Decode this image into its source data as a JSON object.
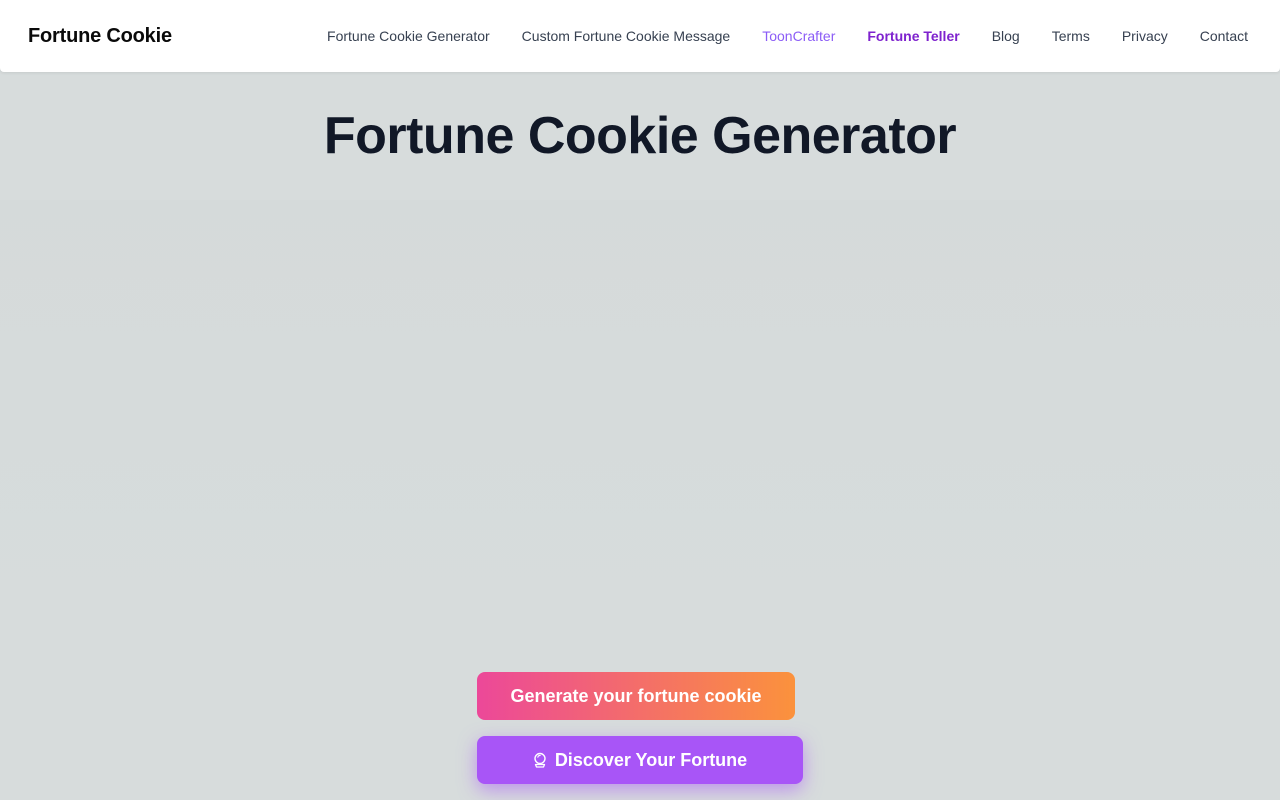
{
  "header": {
    "brand": "Fortune Cookie",
    "nav": [
      {
        "label": "Fortune Cookie Generator"
      },
      {
        "label": "Custom Fortune Cookie Message"
      },
      {
        "label": "ToonCrafter"
      },
      {
        "label": "Fortune Teller"
      },
      {
        "label": "Blog"
      },
      {
        "label": "Terms"
      },
      {
        "label": "Privacy"
      },
      {
        "label": "Contact"
      }
    ]
  },
  "main": {
    "title": "Fortune Cookie Generator",
    "generate_label": "Generate your fortune cookie",
    "discover_label": "Discover Your Fortune",
    "discover_icon": "crystal-ball-icon"
  },
  "colors": {
    "background": "#d7dcdc",
    "accent_purple": "#a855f7",
    "gradient_start": "#ec4899",
    "gradient_end": "#fb923c"
  }
}
